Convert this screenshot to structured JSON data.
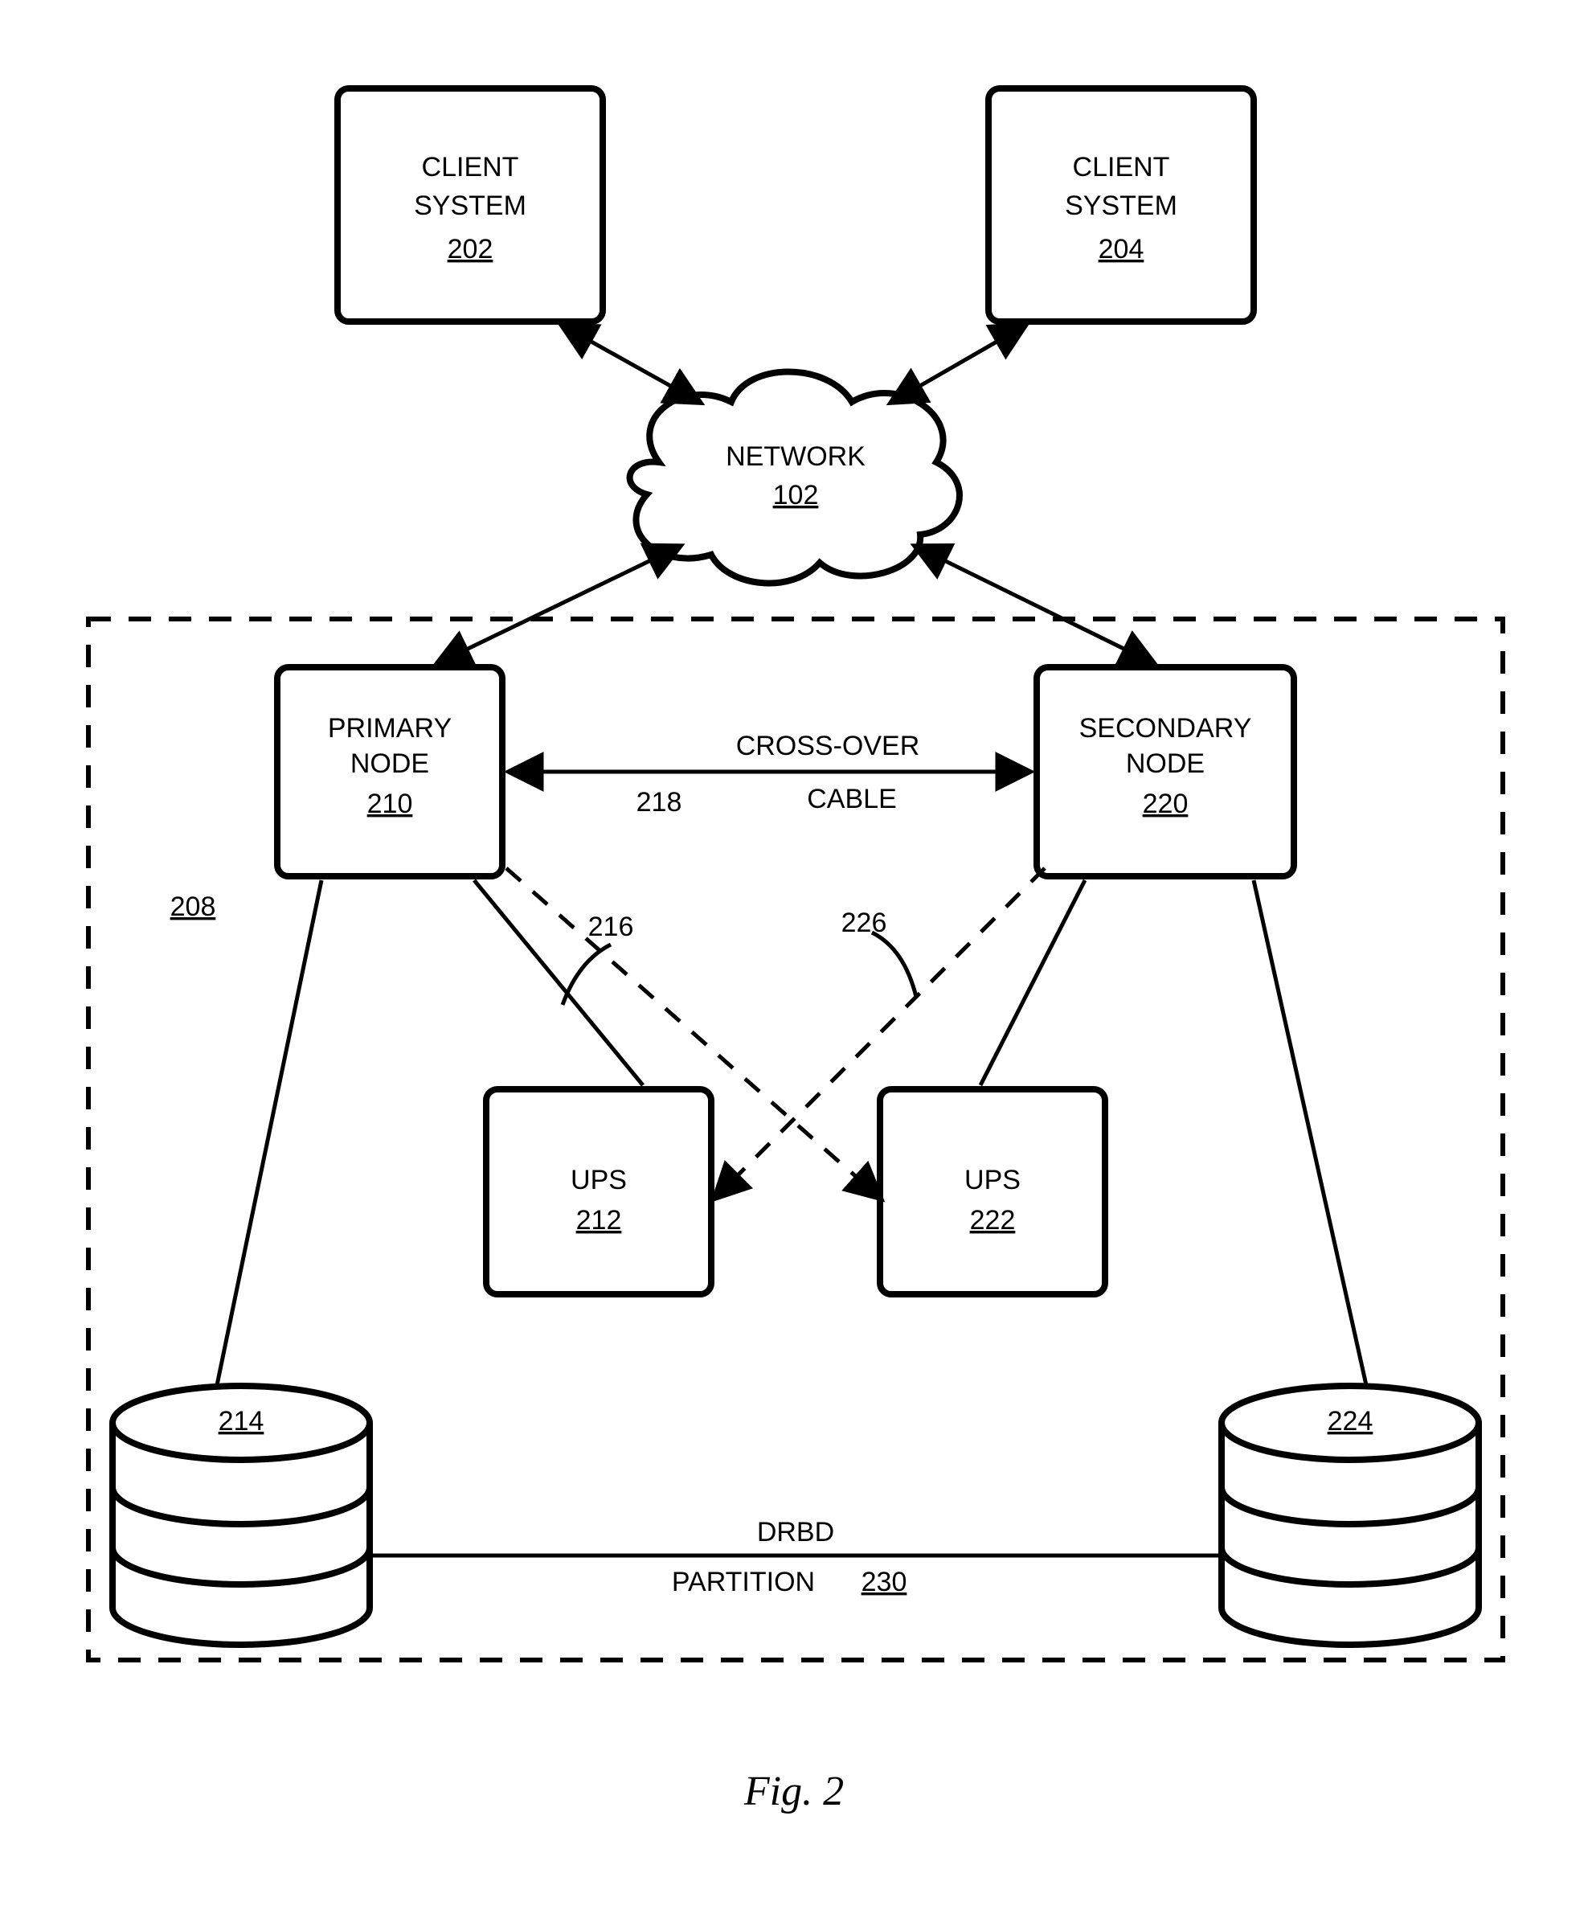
{
  "client1": {
    "title": "CLIENT",
    "sub": "SYSTEM",
    "ref": "202"
  },
  "client2": {
    "title": "CLIENT",
    "sub": "SYSTEM",
    "ref": "204"
  },
  "network": {
    "title": "NETWORK",
    "ref": "102"
  },
  "primary": {
    "title": "PRIMARY",
    "sub": "NODE",
    "ref": "210"
  },
  "secondary": {
    "title": "SECONDARY",
    "sub": "NODE",
    "ref": "220"
  },
  "crossover": {
    "line1": "CROSS-OVER",
    "line2": "CABLE",
    "ref": "218"
  },
  "edge_216": "216",
  "edge_226": "226",
  "cluster_ref": "208",
  "ups1": {
    "title": "UPS",
    "ref": "212"
  },
  "ups2": {
    "title": "UPS",
    "ref": "222"
  },
  "db1_ref": "214",
  "db2_ref": "224",
  "drbd": {
    "line1": "DRBD",
    "line2": "PARTITION",
    "ref": "230"
  },
  "figure": "Fig. 2"
}
